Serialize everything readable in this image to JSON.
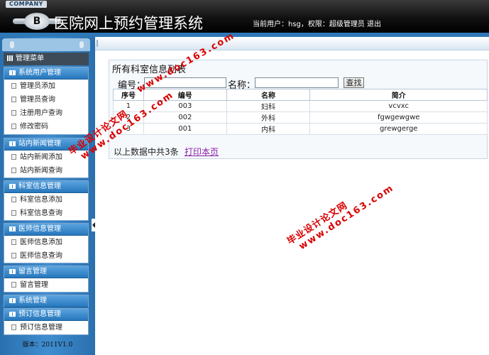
{
  "header": {
    "company_badge": "COMPANY",
    "logo_letter": "B",
    "app_title": "医院网上预约管理系统",
    "user_info": "当前用户：hsg，权限：超级管理员",
    "logout_label": "退出"
  },
  "sidebar": {
    "menu_title": "管理菜单",
    "groups": [
      {
        "title": "系统用户管理",
        "items": [
          "管理员添加",
          "管理员查询",
          "注册用户查询",
          "修改密码"
        ]
      },
      {
        "title": "站内新闻管理",
        "items": [
          "站内新闻添加",
          "站内新闻查询"
        ]
      },
      {
        "title": "科室信息管理",
        "items": [
          "科室信息添加",
          "科室信息查询"
        ]
      },
      {
        "title": "医师信息管理",
        "items": [
          "医师信息添加",
          "医师信息查询"
        ]
      },
      {
        "title": "留言管理",
        "items": [
          "留言管理"
        ]
      },
      {
        "title": "系统管理",
        "items": []
      },
      {
        "title": "预订信息管理",
        "items": [
          "预订信息管理"
        ]
      }
    ],
    "version": "版本：2011V1.0"
  },
  "main": {
    "list_title": "所有科室信息列表",
    "search": {
      "code_label": "编号：",
      "code_value": "",
      "name_label": "名称：",
      "name_value": "",
      "button_label": "查找"
    },
    "table": {
      "headers": [
        "序号",
        "编号",
        "名称",
        "简介"
      ],
      "rows": [
        [
          "1",
          "003",
          "妇科",
          "vcvxc"
        ],
        [
          "2",
          "002",
          "外科",
          "fgwgewgwe"
        ],
        [
          "3",
          "001",
          "内科",
          "grewgerge"
        ]
      ]
    },
    "summary": "以上数据中共3条",
    "print_label": "打印本页"
  },
  "watermarks": [
    {
      "line1": "毕业设计论文网",
      "line2": "www.doc163.com"
    },
    {
      "line1": "毕业设计论文网",
      "line2": "www.doc163.com"
    },
    {
      "line1": "",
      "line2": "www.doc163.com"
    }
  ],
  "colors": {
    "header_bg": "#000000",
    "sidebar_bg": "#3f8ed0",
    "group_header": "#2777bd",
    "print_link": "#8b1fa9",
    "watermark": "#d90000"
  }
}
